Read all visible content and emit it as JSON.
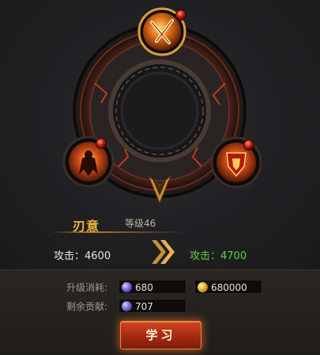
{
  "skill": {
    "name": "刃意",
    "level_text": "等级46",
    "current_attack": "攻击：4600",
    "next_attack": "攻击：4700"
  },
  "upgrade": {
    "cost_label": "升级消耗:",
    "cost_gems": "680",
    "cost_gold": "680000",
    "remaining_label": "剩余贡献:",
    "remaining_gems": "707"
  },
  "button": {
    "learn_label": "学习"
  },
  "icons": {
    "top": "crossed-blades-skill-icon",
    "left": "fire-warrior-skill-icon",
    "right": "flaming-shield-skill-icon",
    "next": "double-chevron-right-icon",
    "gem": "purple-gem-icon",
    "coin": "gold-coin-icon"
  },
  "colors": {
    "accent": "#f0b43a",
    "next_value": "#5fd13a",
    "button": "#c03a18"
  }
}
